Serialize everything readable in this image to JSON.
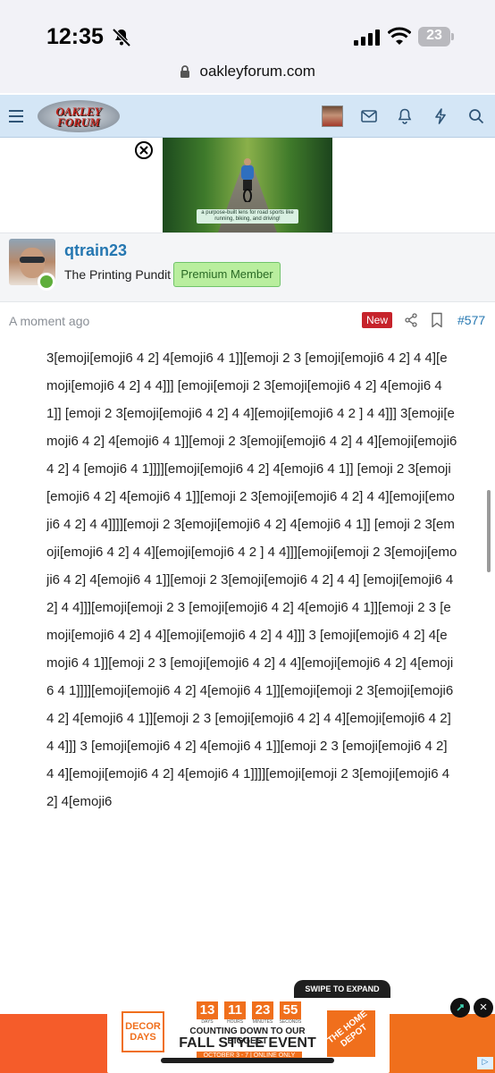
{
  "status_bar": {
    "time": "12:35",
    "battery": "23"
  },
  "browser": {
    "url": "oakleyforum.com"
  },
  "header": {
    "logo_text_line1": "OAKLEY",
    "logo_text_line2": "FORUM"
  },
  "ad": {
    "caption": "a purpose-built lens for road sports like running, biking, and driving!"
  },
  "post": {
    "author": "qtrain23",
    "user_title": "The Printing Pundit",
    "badge": "Premium Member",
    "time": "A moment ago",
    "new_label": "New",
    "number": "#577",
    "body": "3[emoji[emoji6 4 2] 4[emoji6 4 1]][emoji 2 3 [emoji[emoji6 4 2] 4 4][emoji[emoji6 4 2] 4 4]]] [emoji[emoji 2 3[emoji[emoji6 4 2] 4[emoji6 4 1]] [emoji 2 3[emoji[emoji6 4 2] 4 4][emoji[emoji6 4 2 ] 4 4]]] 3[emoji[emoji6 4 2] 4[emoji6 4 1]][emoji 2 3[emoji[emoji6 4 2] 4 4][emoji[emoji6 4 2] 4 [emoji6 4 1]]]][emoji[emoji6 4 2] 4[emoji6 4 1]] [emoji 2 3[emoji[emoji6 4 2] 4[emoji6 4 1]][emoji 2 3[emoji[emoji6 4 2] 4 4][emoji[emoji6 4 2] 4 4]]]][emoji 2 3[emoji[emoji6 4 2] 4[emoji6 4 1]] [emoji 2 3[emoji[emoji6 4 2] 4 4][emoji[emoji6 4 2 ] 4 4]]][emoji[emoji 2 3[emoji[emoji6 4 2] 4[emoji6 4 1]][emoji 2 3[emoji[emoji6 4 2] 4 4] [emoji[emoji6 4 2] 4 4]]][emoji[emoji 2 3 [emoji[emoji6 4 2] 4[emoji6 4 1]][emoji 2 3 [emoji[emoji6 4 2] 4 4][emoji[emoji6 4 2] 4 4]]] 3 [emoji[emoji6 4 2] 4[emoji6 4 1]][emoji 2 3 [emoji[emoji6 4 2] 4 4][emoji[emoji6 4 2] 4[emoji6 4 1]]]][emoji[emoji6 4 2] 4[emoji6 4 1]][emoji[emoji 2 3[emoji[emoji6 4 2] 4[emoji6 4 1]][emoji 2 3 [emoji[emoji6 4 2] 4 4][emoji[emoji6 4 2] 4 4]]] 3 [emoji[emoji6 4 2] 4[emoji6 4 1]][emoji 2 3 [emoji[emoji6 4 2] 4 4][emoji[emoji6 4 2] 4[emoji6 4 1]]]][emoji[emoji 2 3[emoji[emoji6 4 2] 4[emoji6"
  },
  "bottom_ad": {
    "swipe": "SWIPE TO EXPAND",
    "decor_days": "DECOR DAYS",
    "countdown": [
      {
        "value": "13",
        "label": "DAYS"
      },
      {
        "value": "11",
        "label": "HOURS"
      },
      {
        "value": "23",
        "label": "MINUTES"
      },
      {
        "value": "55",
        "label": "SECONDS"
      }
    ],
    "subhead": "COUNTING DOWN TO OUR BIGGEST",
    "headline": "FALL STYLE EVENT",
    "dates": "OCTOBER 3 - 7 | ONLINE ONLY",
    "brand": "THE HOME DEPOT",
    "close": "×"
  },
  "colors": {
    "header_bg": "#d4e6f6",
    "link": "#2577b1",
    "new_badge": "#c6232b",
    "premium_badge": "#b9ee9e",
    "ad_orange": "#f06f1c"
  },
  "icons": [
    "bell-off-icon",
    "signal-icon",
    "wifi-icon",
    "battery-icon",
    "lock-icon",
    "menu-icon",
    "mail-icon",
    "bell-icon",
    "lightning-icon",
    "search-icon",
    "close-icon",
    "share-icon",
    "bookmark-icon",
    "info-icon"
  ]
}
